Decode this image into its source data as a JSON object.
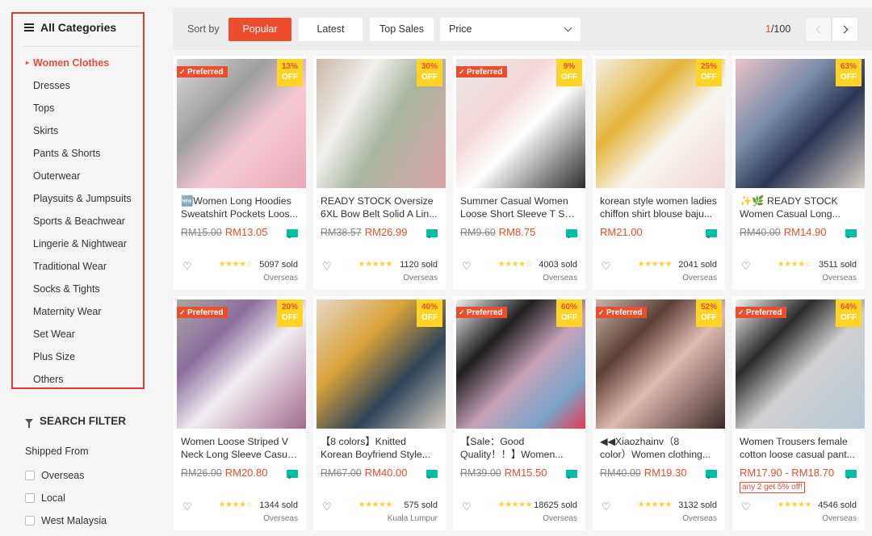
{
  "sidebar": {
    "title": "All Categories",
    "categories": [
      {
        "label": "Women Clothes",
        "active": true
      },
      {
        "label": "Dresses"
      },
      {
        "label": "Tops"
      },
      {
        "label": "Skirts"
      },
      {
        "label": "Pants & Shorts"
      },
      {
        "label": "Outerwear"
      },
      {
        "label": "Playsuits & Jumpsuits"
      },
      {
        "label": "Sports & Beachwear"
      },
      {
        "label": "Lingerie & Nightwear"
      },
      {
        "label": "Traditional Wear"
      },
      {
        "label": "Socks & Tights"
      },
      {
        "label": "Maternity Wear"
      },
      {
        "label": "Set Wear"
      },
      {
        "label": "Plus Size"
      },
      {
        "label": "Others"
      }
    ],
    "filter_title": "SEARCH FILTER",
    "shipped_from_title": "Shipped From",
    "shipped_options": [
      "Overseas",
      "Local",
      "West Malaysia"
    ]
  },
  "sortbar": {
    "label": "Sort by",
    "options": [
      "Popular",
      "Latest",
      "Top Sales"
    ],
    "price_label": "Price",
    "page_current": "1",
    "page_total": "/100"
  },
  "colors": {
    "accent": "#ee4d2d",
    "discount_badge": "#ffd424",
    "free_shipping": "#00bfa5",
    "star": "#ffce3d",
    "highlight_box": "#e53935"
  },
  "products": [
    {
      "line1": "🆕Women Long Hoodies",
      "line2": "Sweatshirt Pockets Loos...",
      "orig": "RM15.00",
      "price": "RM13.05",
      "discount": "13%",
      "off": "OFF",
      "preferred": "Preferred",
      "stars": "★★★★☆",
      "rating": 4,
      "sold": "5097 sold",
      "loc": "Overseas",
      "promo": ""
    },
    {
      "line1": "READY STOCK Oversize",
      "line2": "6XL Bow Belt Solid A Lin...",
      "orig": "RM38.57",
      "price": "RM26.99",
      "discount": "30%",
      "off": "OFF",
      "preferred": "",
      "stars": "★★★★★",
      "rating": 5,
      "sold": "1120 sold",
      "loc": "Overseas",
      "promo": ""
    },
    {
      "line1": "Summer Casual Women",
      "line2": "Loose Short Sleeve T Shi...",
      "orig": "RM9.60",
      "price": "RM8.75",
      "discount": "9%",
      "off": "OFF",
      "preferred": "Preferred",
      "stars": "★★★★☆",
      "rating": 4,
      "sold": "4003 sold",
      "loc": "Overseas",
      "promo": ""
    },
    {
      "line1": "korean style women ladies",
      "line2": "chiffon shirt blouse baju...",
      "orig": "",
      "price": "RM21.00",
      "discount": "25%",
      "off": "OFF",
      "preferred": "",
      "stars": "★★★★★",
      "rating": 5,
      "sold": "2041 sold",
      "loc": "Overseas",
      "promo": ""
    },
    {
      "line1": "✨🌿 READY STOCK",
      "line2": "Women Casual Long...",
      "orig": "RM40.00",
      "price": "RM14.90",
      "discount": "63%",
      "off": "OFF",
      "preferred": "",
      "stars": "★★★★☆",
      "rating": 4,
      "sold": "3511 sold",
      "loc": "Overseas",
      "promo": ""
    },
    {
      "line1": "Women Loose Striped V",
      "line2": "Neck Long Sleeve Casual...",
      "orig": "RM26.00",
      "price": "RM20.80",
      "discount": "20%",
      "off": "OFF",
      "preferred": "Preferred",
      "stars": "★★★★☆",
      "rating": 4,
      "sold": "1344 sold",
      "loc": "Overseas",
      "promo": ""
    },
    {
      "line1": "【8 colors】Knitted",
      "line2": "Korean Boyfriend Style...",
      "orig": "RM67.00",
      "price": "RM40.00",
      "discount": "40%",
      "off": "OFF",
      "preferred": "",
      "stars": "★★★★★",
      "rating": 5,
      "sold": "575 sold",
      "loc": "Kuala Lumpur",
      "promo": ""
    },
    {
      "line1": "【Sale：Good",
      "line2": "Quality！！】Women...",
      "orig": "RM39.00",
      "price": "RM15.50",
      "discount": "60%",
      "off": "OFF",
      "preferred": "Preferred",
      "stars": "★★★★★",
      "rating": 5,
      "sold": "18625 sold",
      "loc": "Overseas",
      "promo": ""
    },
    {
      "line1": "◀◀Xiaozhainv（8",
      "line2": "color）Women clothing...",
      "orig": "RM40.00",
      "price": "RM19.30",
      "discount": "52%",
      "off": "OFF",
      "preferred": "Preferred",
      "stars": "★★★★★",
      "rating": 5,
      "sold": "3132 sold",
      "loc": "Overseas",
      "promo": ""
    },
    {
      "line1": "Women Trousers female",
      "line2": "cotton loose casual pant...",
      "orig": "",
      "price": "RM17.90 - RM18.70",
      "discount": "64%",
      "off": "OFF",
      "preferred": "Preferred",
      "stars": "★★★★★",
      "rating": 5,
      "sold": "4546 sold",
      "loc": "Overseas",
      "promo": "any 2 get 5% off!"
    }
  ]
}
